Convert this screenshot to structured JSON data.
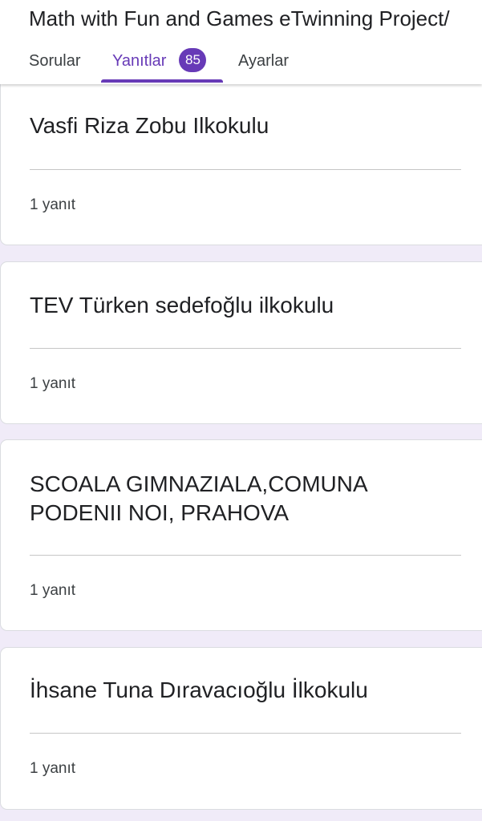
{
  "form": {
    "title": "Math with Fun and Games eTwinning Project/"
  },
  "tabs": {
    "questions_label": "Sorular",
    "responses_label": "Yanıtlar",
    "responses_count": "85",
    "settings_label": "Ayarlar",
    "active": "responses"
  },
  "colors": {
    "accent": "#673ab7",
    "background": "#f0ebf8"
  },
  "responses": [
    {
      "answer": "Vasfi Riza Zobu Ilkokulu",
      "count_label": "1 yanıt"
    },
    {
      "answer": "TEV Türken sedefoğlu ilkokulu",
      "count_label": "1 yanıt"
    },
    {
      "answer": "SCOALA GIMNAZIALA,COMUNA PODENII NOI, PRAHOVA",
      "count_label": "1 yanıt"
    },
    {
      "answer": "İhsane Tuna Dıravacıoğlu İlkokulu",
      "count_label": "1 yanıt"
    }
  ]
}
